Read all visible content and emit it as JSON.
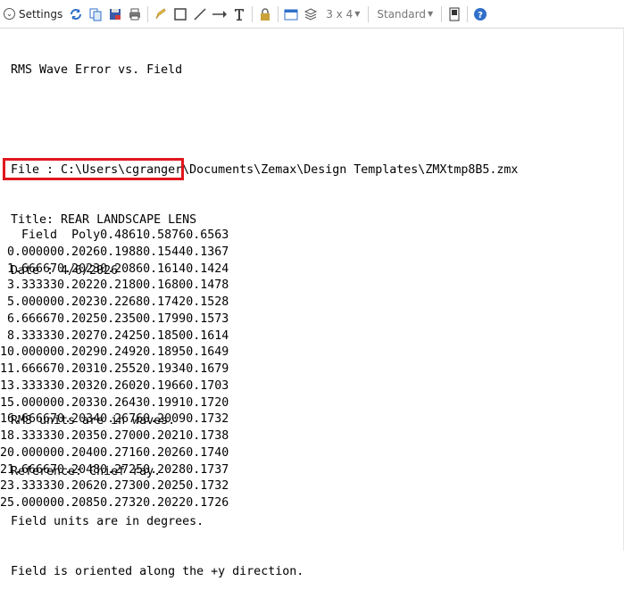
{
  "toolbar": {
    "settings_label": "Settings",
    "layout_value": "3 x 4",
    "style_value": "Standard",
    "icons": [
      "refresh-icon",
      "copy-icon",
      "save-icon",
      "print-icon",
      "pencil-icon",
      "rectangle-icon",
      "line-icon",
      "arrow-icon",
      "text-icon",
      "lock-icon",
      "window-icon",
      "layers-icon",
      "window-split-icon",
      "help-icon"
    ]
  },
  "report": {
    "title": "RMS Wave Error vs. Field",
    "file_line": "File : C:\\Users\\cgranger\\Documents\\Zemax\\Design Templates\\ZMXtmp8B5.zmx",
    "title_line": "Title: REAR LANDSCAPE LENS",
    "date_line": "Date : 4/6/2026",
    "notes": [
      "RMS units are in waves.",
      "Reference: Chief ray.",
      "Field units are in degrees.",
      "Field is oriented along the +y direction."
    ]
  },
  "table": {
    "headers": [
      "Field",
      "Poly",
      "0.4861",
      "0.5876",
      "0.6563"
    ],
    "rows": [
      [
        "0.00000",
        "0.2026",
        "0.1988",
        "0.1544",
        "0.1367"
      ],
      [
        "1.66667",
        "0.2023",
        "0.2086",
        "0.1614",
        "0.1424"
      ],
      [
        "3.33333",
        "0.2022",
        "0.2180",
        "0.1680",
        "0.1478"
      ],
      [
        "5.00000",
        "0.2023",
        "0.2268",
        "0.1742",
        "0.1528"
      ],
      [
        "6.66667",
        "0.2025",
        "0.2350",
        "0.1799",
        "0.1573"
      ],
      [
        "8.33333",
        "0.2027",
        "0.2425",
        "0.1850",
        "0.1614"
      ],
      [
        "10.00000",
        "0.2029",
        "0.2492",
        "0.1895",
        "0.1649"
      ],
      [
        "11.66667",
        "0.2031",
        "0.2552",
        "0.1934",
        "0.1679"
      ],
      [
        "13.33333",
        "0.2032",
        "0.2602",
        "0.1966",
        "0.1703"
      ],
      [
        "15.00000",
        "0.2033",
        "0.2643",
        "0.1991",
        "0.1720"
      ],
      [
        "16.66667",
        "0.2034",
        "0.2676",
        "0.2009",
        "0.1732"
      ],
      [
        "18.33333",
        "0.2035",
        "0.2700",
        "0.2021",
        "0.1738"
      ],
      [
        "20.00000",
        "0.2040",
        "0.2716",
        "0.2026",
        "0.1740"
      ],
      [
        "21.66667",
        "0.2048",
        "0.2725",
        "0.2028",
        "0.1737"
      ],
      [
        "23.33333",
        "0.2062",
        "0.2730",
        "0.2025",
        "0.1732"
      ],
      [
        "25.00000",
        "0.2085",
        "0.2732",
        "0.2022",
        "0.1726"
      ]
    ]
  },
  "colors": {
    "highlight_box": "#e0161e",
    "icon_blue": "#2f6fc9"
  }
}
